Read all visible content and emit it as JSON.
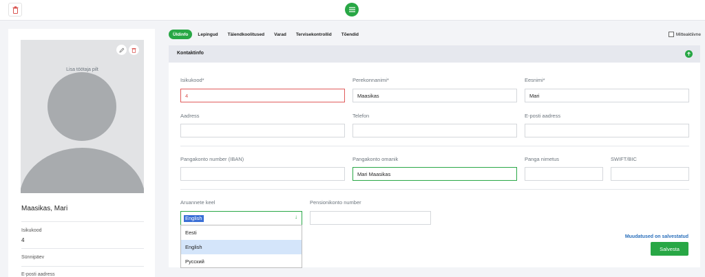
{
  "colors": {
    "accent": "#28a745",
    "error": "#e05a5a",
    "link": "#2a6fbb",
    "selection": "#3a6fd6"
  },
  "icons": {
    "delete": "trash-icon",
    "menu": "hamburger-icon",
    "edit": "pencil-icon",
    "collapse": "chevron-up-icon",
    "dropdown": "chevron-down-icon"
  },
  "profile": {
    "photo_label": "Lisa töötaja pilt",
    "name": "Maasikas, Mari",
    "fields": [
      {
        "label": "Isikukood",
        "value": "4"
      },
      {
        "label": "Sünnipäev",
        "value": ""
      },
      {
        "label": "E-posti aadress",
        "value": ""
      }
    ]
  },
  "tabs": [
    "Üldinfo",
    "Lepingud",
    "Täiendkoolitused",
    "Varad",
    "Tervisekontrollid",
    "Tõendid"
  ],
  "active_tab": "Üldinfo",
  "inactive_label": "Mitteaktiivne",
  "section": {
    "title": "Kontaktinfo",
    "fields": {
      "personal_code": {
        "label": "Isikukood*",
        "value": "4"
      },
      "last_name": {
        "label": "Perekonnanimi*",
        "value": "Maasikas"
      },
      "first_name": {
        "label": "Eesnimi*",
        "value": "Mari"
      },
      "address": {
        "label": "Aadress",
        "value": ""
      },
      "phone": {
        "label": "Telefon",
        "value": ""
      },
      "email": {
        "label": "E-posti aadress",
        "value": ""
      },
      "iban": {
        "label": "Pangakonto number (IBAN)",
        "value": ""
      },
      "account_owner": {
        "label": "Pangakonto omanik",
        "value": "Mari Maasikas"
      },
      "bank_name": {
        "label": "Panga nimetus",
        "value": ""
      },
      "swift": {
        "label": "SWIFT/BIC",
        "value": ""
      },
      "report_language": {
        "label": "Aruannete keel",
        "value": "English",
        "options": [
          "Eesti",
          "English",
          "Русский"
        ],
        "highlighted": "English"
      },
      "pension_account": {
        "label": "Pensionikonto number",
        "value": ""
      }
    },
    "status_message": "Muudatused on salvestatud",
    "save_label": "Salvesta"
  }
}
